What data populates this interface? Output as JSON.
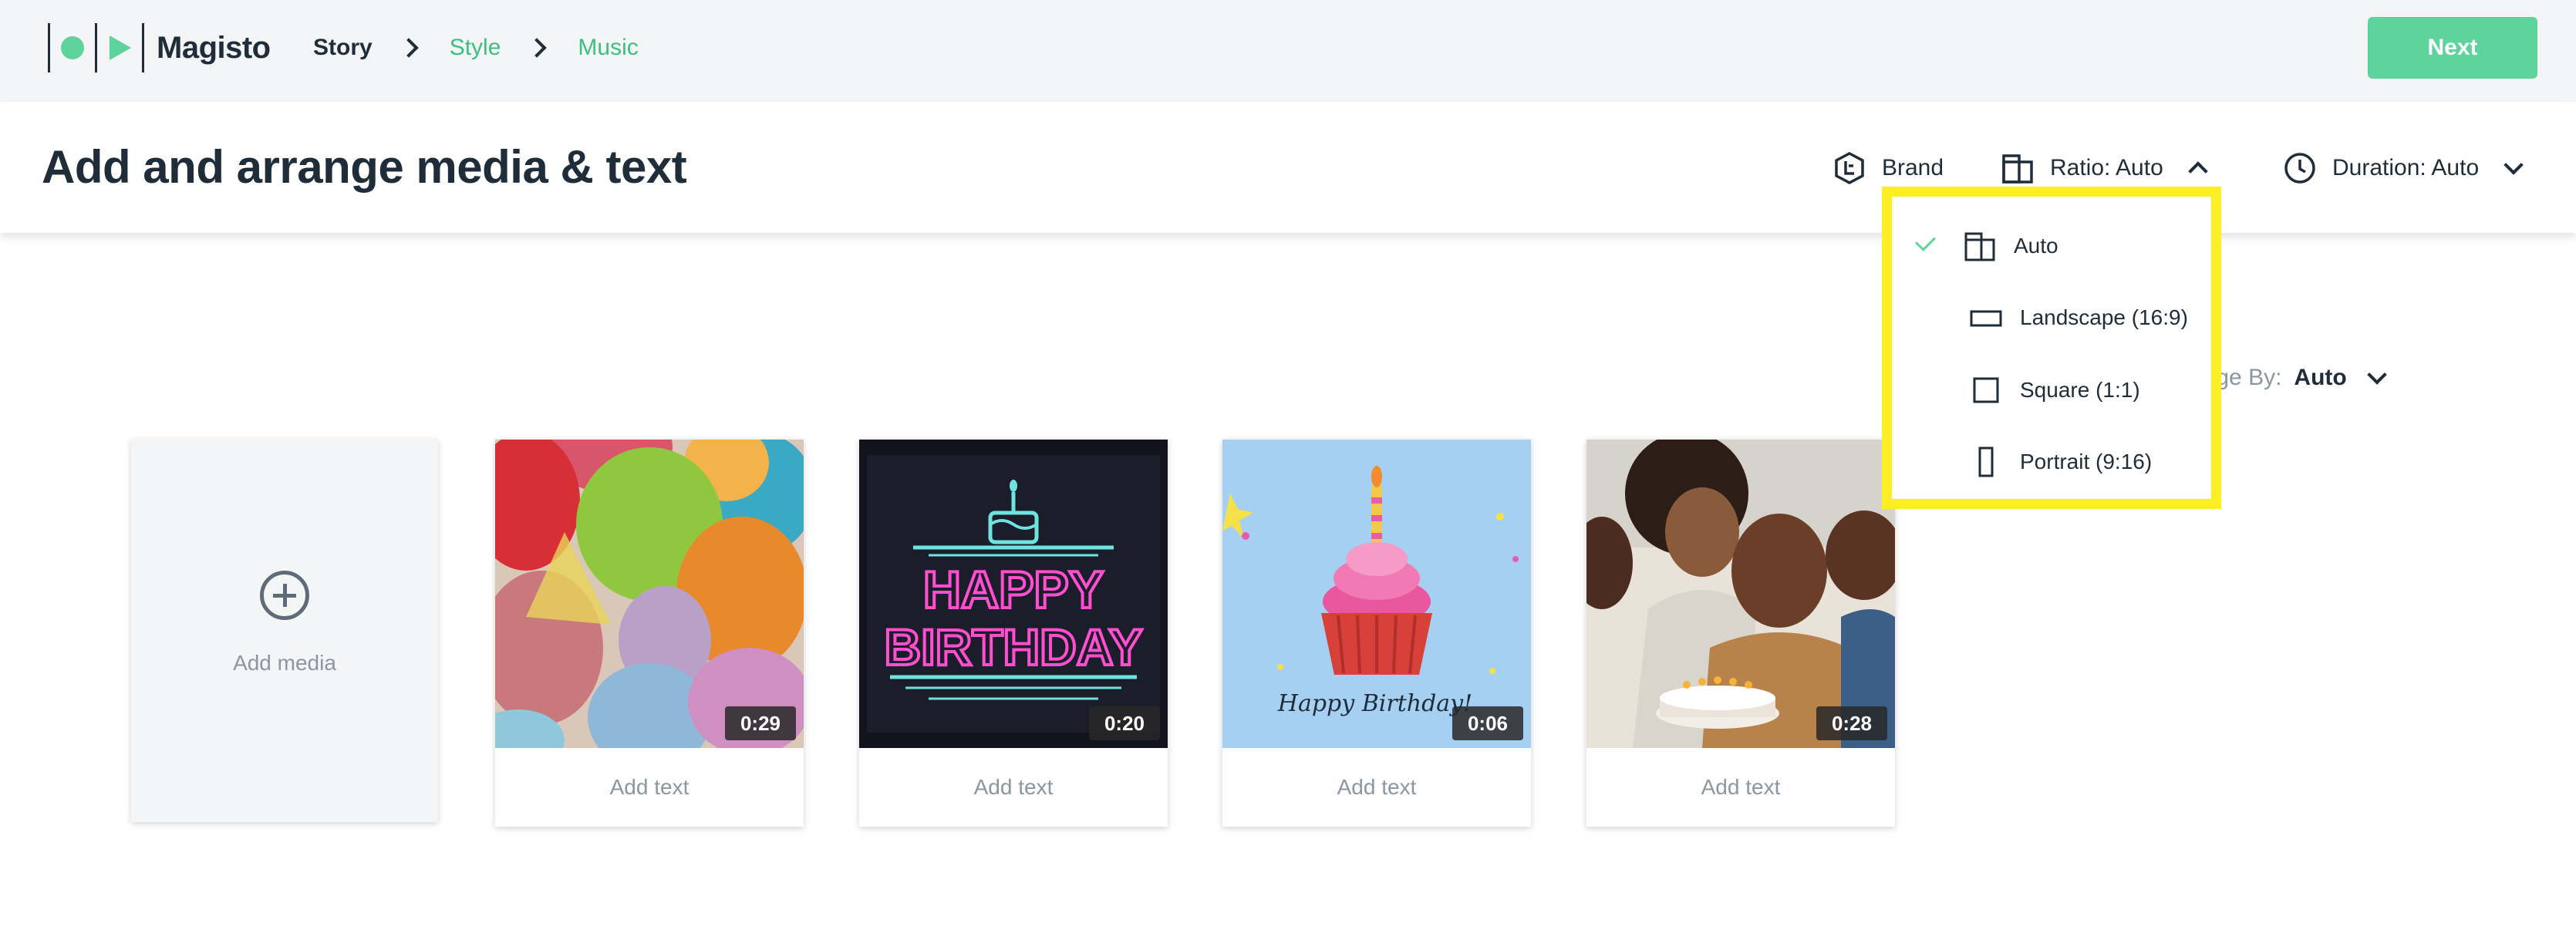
{
  "app": {
    "name": "Magisto"
  },
  "breadcrumbs": [
    {
      "label": "Story",
      "active": true
    },
    {
      "label": "Style",
      "active": false
    },
    {
      "label": "Music",
      "active": false
    }
  ],
  "toolbar": {
    "next_label": "Next"
  },
  "header": {
    "title": "Add and arrange media & text",
    "brand_label": "Brand",
    "ratio_label": "Ratio: Auto",
    "duration_label": "Duration: Auto"
  },
  "arrange": {
    "label": "ange By:",
    "value": "Auto"
  },
  "add_media": {
    "label": "Add media"
  },
  "media": [
    {
      "duration": "0:29",
      "add_text": "Add text",
      "subject": "balloons"
    },
    {
      "duration": "0:20",
      "add_text": "Add text",
      "subject": "neon-happy-birthday",
      "sign_lines": [
        "HAPPY",
        "BIRTHDAY"
      ]
    },
    {
      "duration": "0:06",
      "add_text": "Add text",
      "subject": "cupcake",
      "caption": "Happy Birthday!"
    },
    {
      "duration": "0:28",
      "add_text": "Add text",
      "subject": "family-cake"
    }
  ],
  "ratio_menu": {
    "selected": "Auto",
    "items": [
      {
        "label": "Auto",
        "icon": "auto-ratio-icon"
      },
      {
        "label": "Landscape (16:9)",
        "icon": "landscape-icon"
      },
      {
        "label": "Square (1:1)",
        "icon": "square-icon"
      },
      {
        "label": "Portrait (9:16)",
        "icon": "portrait-icon"
      }
    ]
  },
  "colors": {
    "accent": "#5fd39c",
    "text": "#1f2d3a",
    "muted": "#8a96a3",
    "highlight": "#fcee21",
    "topbar_bg": "#f4f5f6"
  }
}
